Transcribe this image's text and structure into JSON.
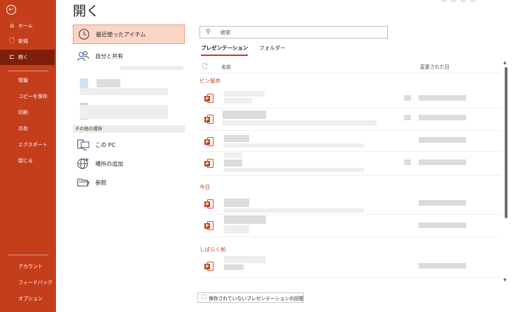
{
  "sidebar": {
    "back_glyph": "←",
    "items": [
      {
        "label": "ホーム",
        "icon": "home-icon",
        "glyph": "⌂"
      },
      {
        "label": "新規",
        "icon": "new-document-icon",
        "glyph": "🗋"
      },
      {
        "label": "開く",
        "icon": "open-folder-icon",
        "glyph": "⊏"
      },
      {
        "label": "情報"
      },
      {
        "label": "コピーを保存"
      },
      {
        "label": "印刷"
      },
      {
        "label": "共有"
      },
      {
        "label": "エクスポート"
      },
      {
        "label": "閉じる"
      }
    ],
    "bottom": [
      {
        "label": "アカウント"
      },
      {
        "label": "フィードバック"
      },
      {
        "label": "オプション"
      }
    ]
  },
  "header": {
    "title": "開く"
  },
  "locations": {
    "recent": "最近使ったアイテム",
    "shared": "自分と共有",
    "other_places_label": "その他の場所",
    "this_pc": "この PC",
    "add_place": "場所の追加",
    "browse": "参照"
  },
  "files": {
    "search_placeholder": "検索",
    "tabs": [
      "プレゼンテーション",
      "フォルダー"
    ],
    "col_name": "名前",
    "col_date": "変更された日",
    "groups": [
      "ピン留め",
      "今日",
      "しばらく前"
    ],
    "file_icon_letter": "P",
    "recover_button": "保存されていないプレゼンテーションの回復"
  },
  "colors": {
    "accent": "#c43e1c",
    "sidebar_active": "#7f1f0b",
    "location_active": "#fbd5c6"
  }
}
